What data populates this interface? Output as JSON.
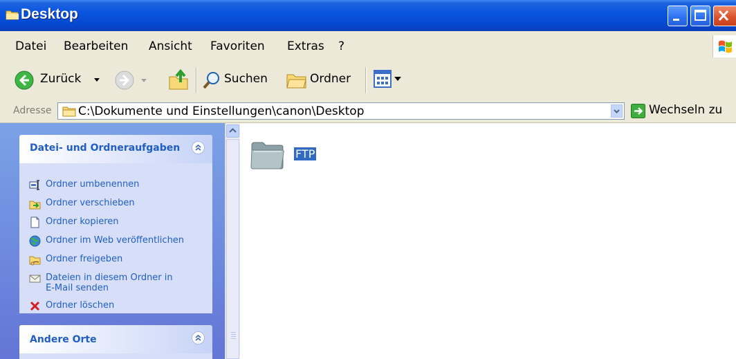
{
  "window": {
    "title": "Desktop"
  },
  "menu": [
    "Datei",
    "Bearbeiten",
    "Ansicht",
    "Favoriten",
    "Extras",
    "?"
  ],
  "toolbar": {
    "back_label": "Zurück",
    "search_label": "Suchen",
    "folders_label": "Ordner"
  },
  "address": {
    "label": "Adresse",
    "value": "C:\\Dokumente und Einstellungen\\canon\\Desktop",
    "go_label": "Wechseln zu"
  },
  "sidebar": {
    "file_tasks": {
      "title": "Datei- und Ordneraufgaben",
      "items": [
        {
          "label": "Ordner umbenennen",
          "icon": "rename-icon"
        },
        {
          "label": "Ordner verschieben",
          "icon": "move-icon"
        },
        {
          "label": "Ordner kopieren",
          "icon": "copy-icon"
        },
        {
          "label": "Ordner im Web veröffentlichen",
          "icon": "publish-web-icon"
        },
        {
          "label": "Ordner freigeben",
          "icon": "share-icon"
        },
        {
          "label": "Dateien in diesem Ordner in",
          "label2": "E-Mail senden",
          "icon": "email-icon"
        },
        {
          "label": "Ordner löschen",
          "icon": "delete-icon"
        }
      ]
    },
    "other_places": {
      "title": "Andere Orte"
    }
  },
  "content": {
    "items": [
      {
        "name": "FTP",
        "type": "folder",
        "selected": true
      }
    ]
  },
  "colors": {
    "titlebar": "#0a55e0",
    "link": "#215dc6",
    "selection": "#316ac5",
    "chrome": "#ece9d8"
  }
}
